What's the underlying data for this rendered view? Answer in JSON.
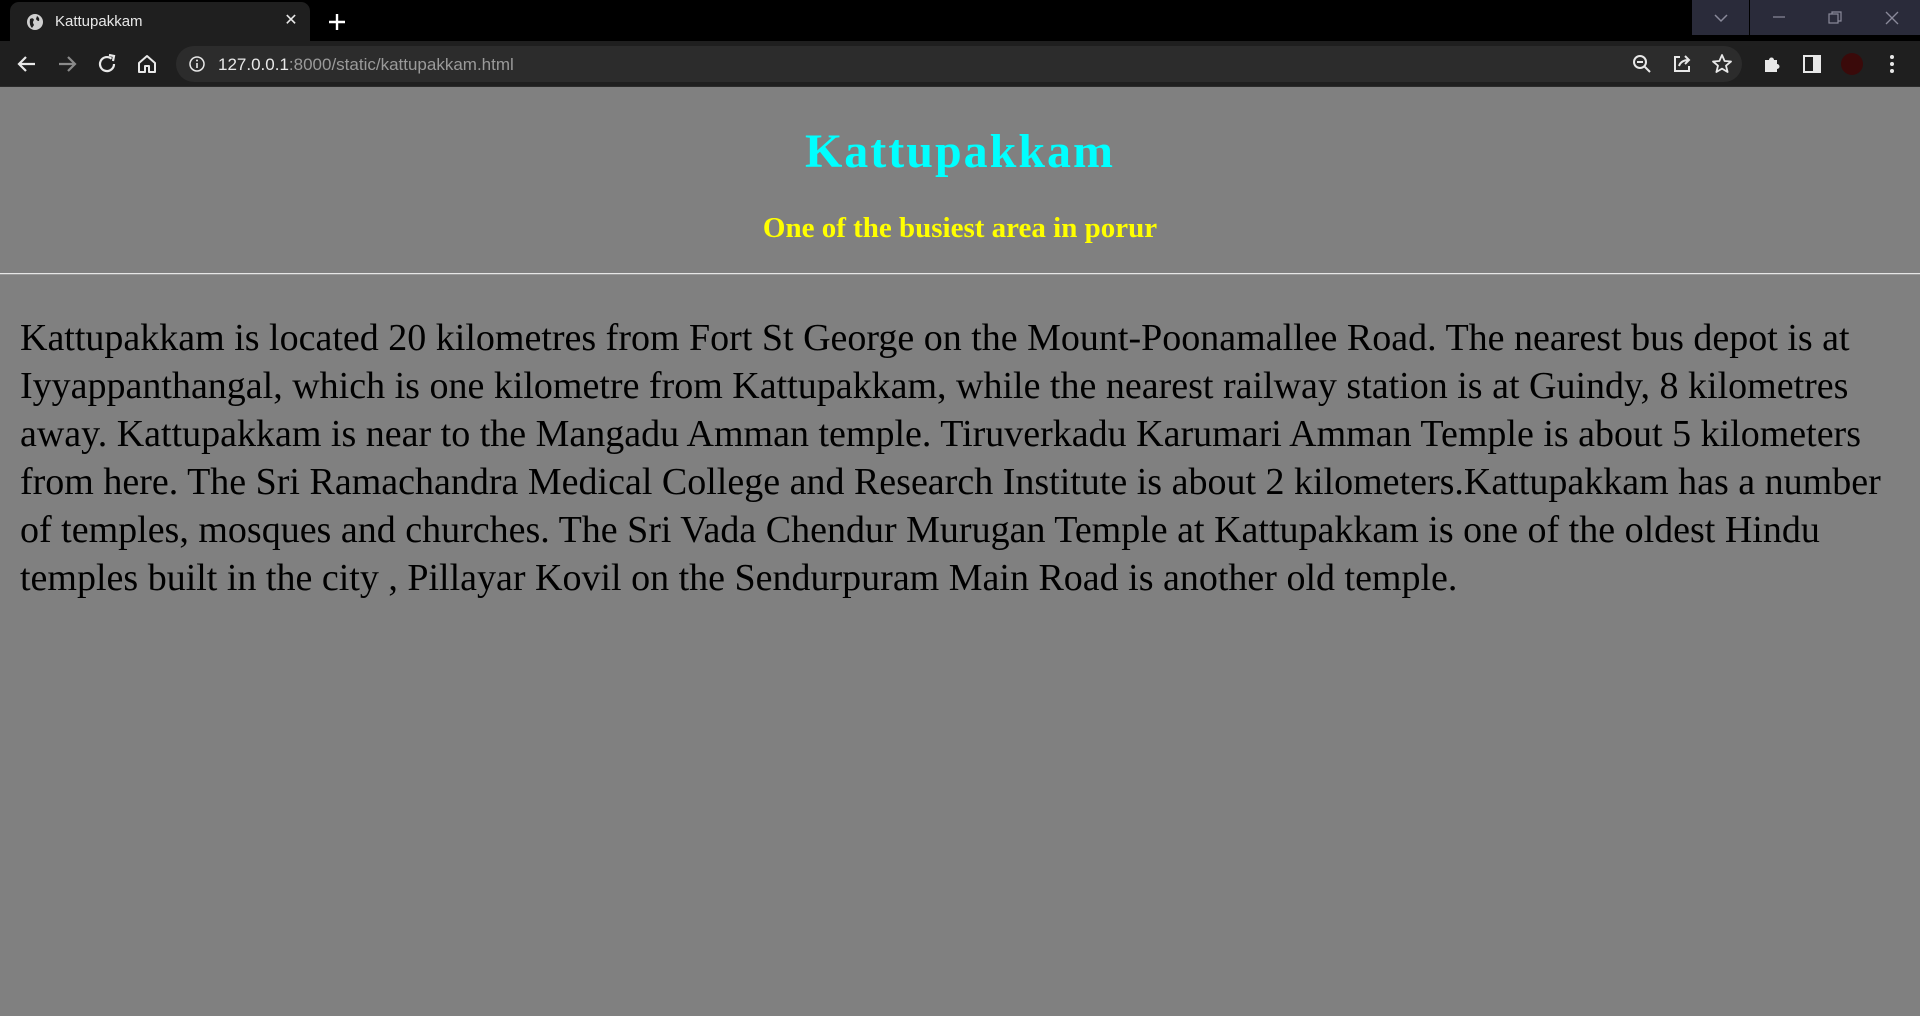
{
  "browser": {
    "tab": {
      "title": "Kattupakkam",
      "close_glyph": "✕"
    },
    "url": {
      "host": "127.0.0.1",
      "rest": ":8000/static/kattupakkam.html"
    },
    "icons": {
      "favicon": "globe-icon",
      "back": "arrow-left-icon",
      "forward": "arrow-right-icon",
      "reload": "reload-icon",
      "home": "home-icon",
      "site_info": "info-icon",
      "zoom": "zoom-out-icon",
      "share": "share-icon",
      "bookmark": "star-icon",
      "extensions": "puzzle-icon",
      "side_panel": "side-panel-icon",
      "profile": "avatar",
      "menu": "kebab-menu-icon"
    }
  },
  "page": {
    "title": "Kattupakkam",
    "subtitle": "One of the busiest area in porur",
    "body": "Kattupakkam is located 20 kilometres from Fort St George on the Mount-Poonamallee Road. The nearest bus depot is at Iyyappanthangal, which is one kilometre from Kattupakkam, while the nearest railway station is at Guindy, 8 kilometres away. Kattupakkam is near to the Mangadu Amman temple. Tiruverkadu Karumari Amman Temple is about 5 kilometers from here. The Sri Ramachandra Medical College and Research Institute is about 2 kilometers.Kattupakkam has a number of temples, mosques and churches. The Sri Vada Chendur Murugan Temple at Kattupakkam is one of the oldest Hindu temples built in the city , Pillayar Kovil on the Sendurpuram Main Road is another old temple."
  },
  "colors": {
    "page_background": "#808080",
    "title": "#00ffff",
    "subtitle": "#ffff00",
    "body_text": "#000000",
    "chrome_dark": "#000000",
    "chrome_toolbar": "#1f1f1f"
  }
}
